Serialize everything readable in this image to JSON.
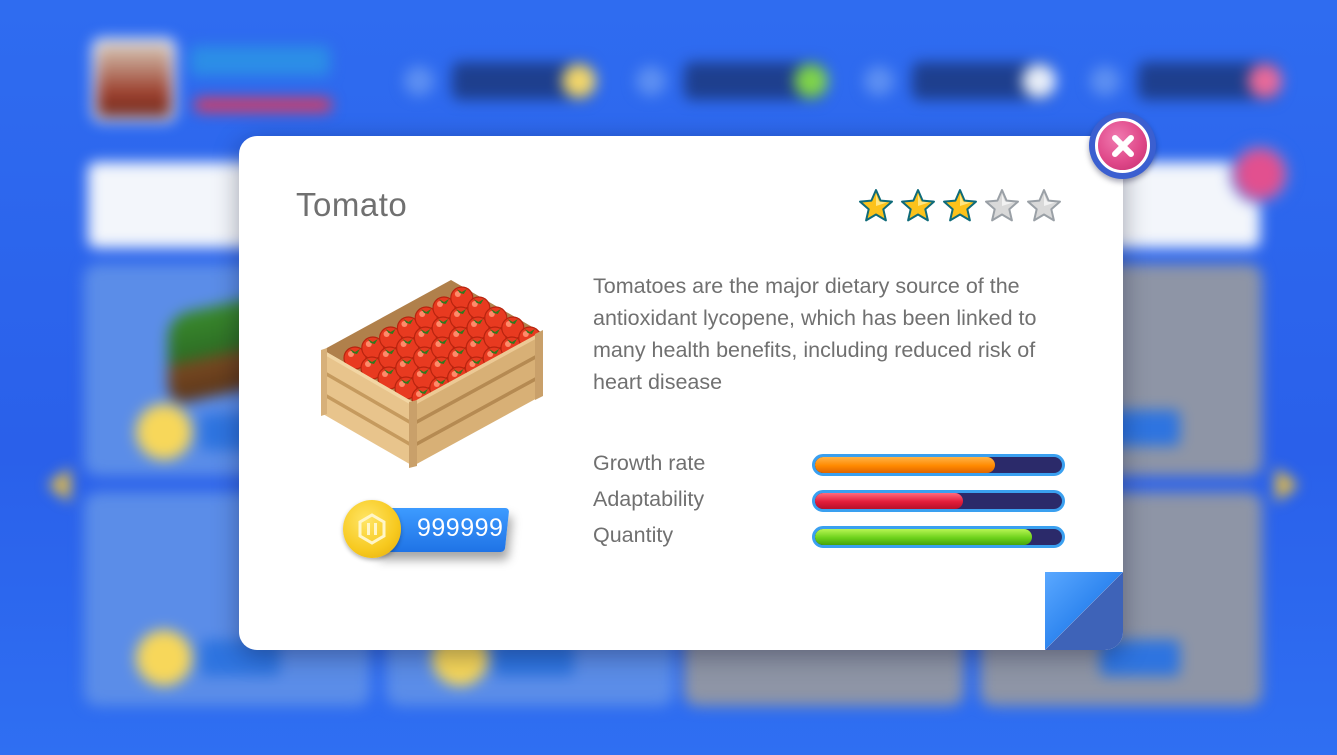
{
  "item": {
    "name": "Tomato",
    "rating": 3,
    "rating_max": 5,
    "description": "Tomatoes are the major dietary source of the antioxidant lycopene, which has been linked to many health benefits, including reduced risk of heart disease",
    "price": "999999"
  },
  "stats": [
    {
      "label": "Growth rate",
      "value": 0.73,
      "color": "#ff8a00"
    },
    {
      "label": "Adaptability",
      "value": 0.6,
      "color": "#e21d3a"
    },
    {
      "label": "Quantity",
      "value": 0.88,
      "color": "#6ed21c"
    }
  ],
  "icons": {
    "close": "close-icon",
    "currency": "coin-icon",
    "item_image": "tomato-crate-image",
    "star_filled": "star-filled-icon",
    "star_empty": "star-empty-icon"
  },
  "colors": {
    "background": "#2f6cf0",
    "panel": "#ffffff",
    "text": "#707070",
    "close_button": "#e0498a",
    "bar_track": "#2b2a6a",
    "bar_border": "#3aa0f0"
  }
}
